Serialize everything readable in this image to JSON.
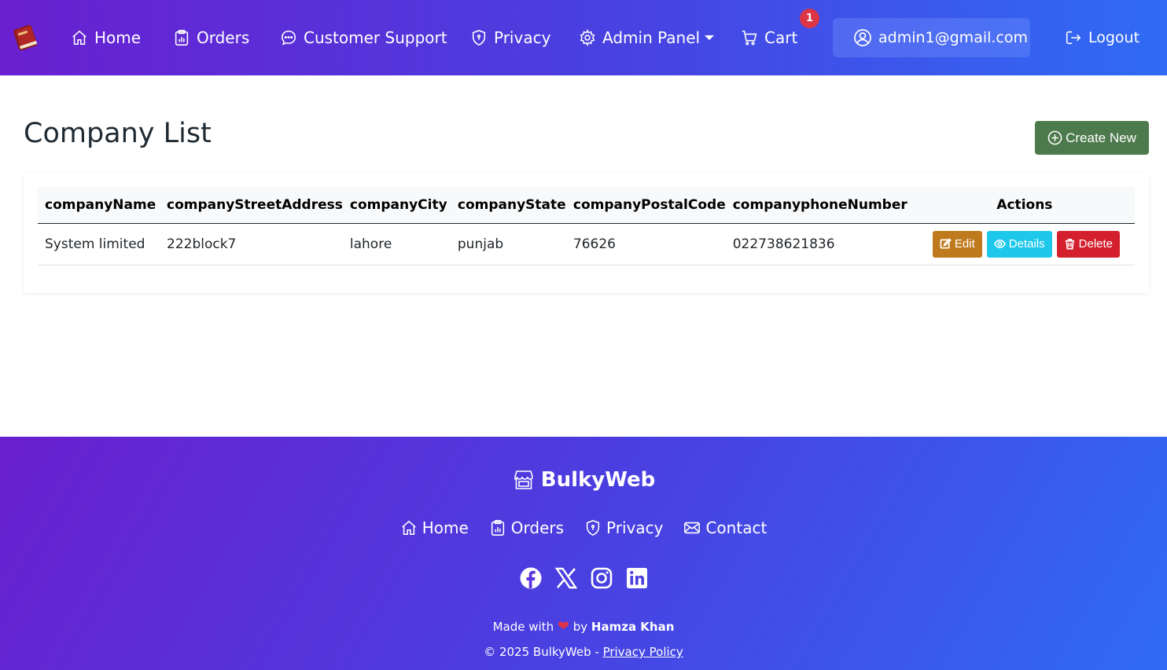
{
  "nav": {
    "home": "Home",
    "orders": "Orders",
    "support": "Customer Support",
    "privacy": "Privacy",
    "admin": "Admin Panel",
    "cart": "Cart",
    "cart_count": "1",
    "user_email": "admin1@gmail.com",
    "logout": "Logout"
  },
  "main": {
    "title": "Company List",
    "create_label": "Create New",
    "table": {
      "headers": [
        "companyName",
        "companyStreetAddress",
        "companyCity",
        "companyState",
        "companyPostalCode",
        "companyphoneNumber",
        "Actions"
      ],
      "rows": [
        {
          "name": "System limited",
          "street": "222block7",
          "city": "lahore",
          "state": "punjab",
          "postal": "76626",
          "phone": "022738621836"
        }
      ],
      "actions": {
        "edit": "Edit",
        "details": "Details",
        "delete": "Delete"
      }
    }
  },
  "footer": {
    "brand": "BulkyWeb",
    "links": {
      "home": "Home",
      "orders": "Orders",
      "privacy": "Privacy",
      "contact": "Contact"
    },
    "social": [
      "facebook-icon",
      "x-icon",
      "instagram-icon",
      "linkedin-icon"
    ],
    "made_with": "Made with",
    "by": "by",
    "author": "Hamza Khan",
    "copyright": "© 2025 BulkyWeb -",
    "privacy_policy": "Privacy Policy"
  },
  "colors": {
    "gradient_start": "#6a1fd0",
    "gradient_end": "#2f6bf5",
    "create": "#4d7a4d",
    "edit": "#c07a1e",
    "details": "#1ec8ea",
    "delete": "#d4202e",
    "badge": "#dc3545"
  }
}
